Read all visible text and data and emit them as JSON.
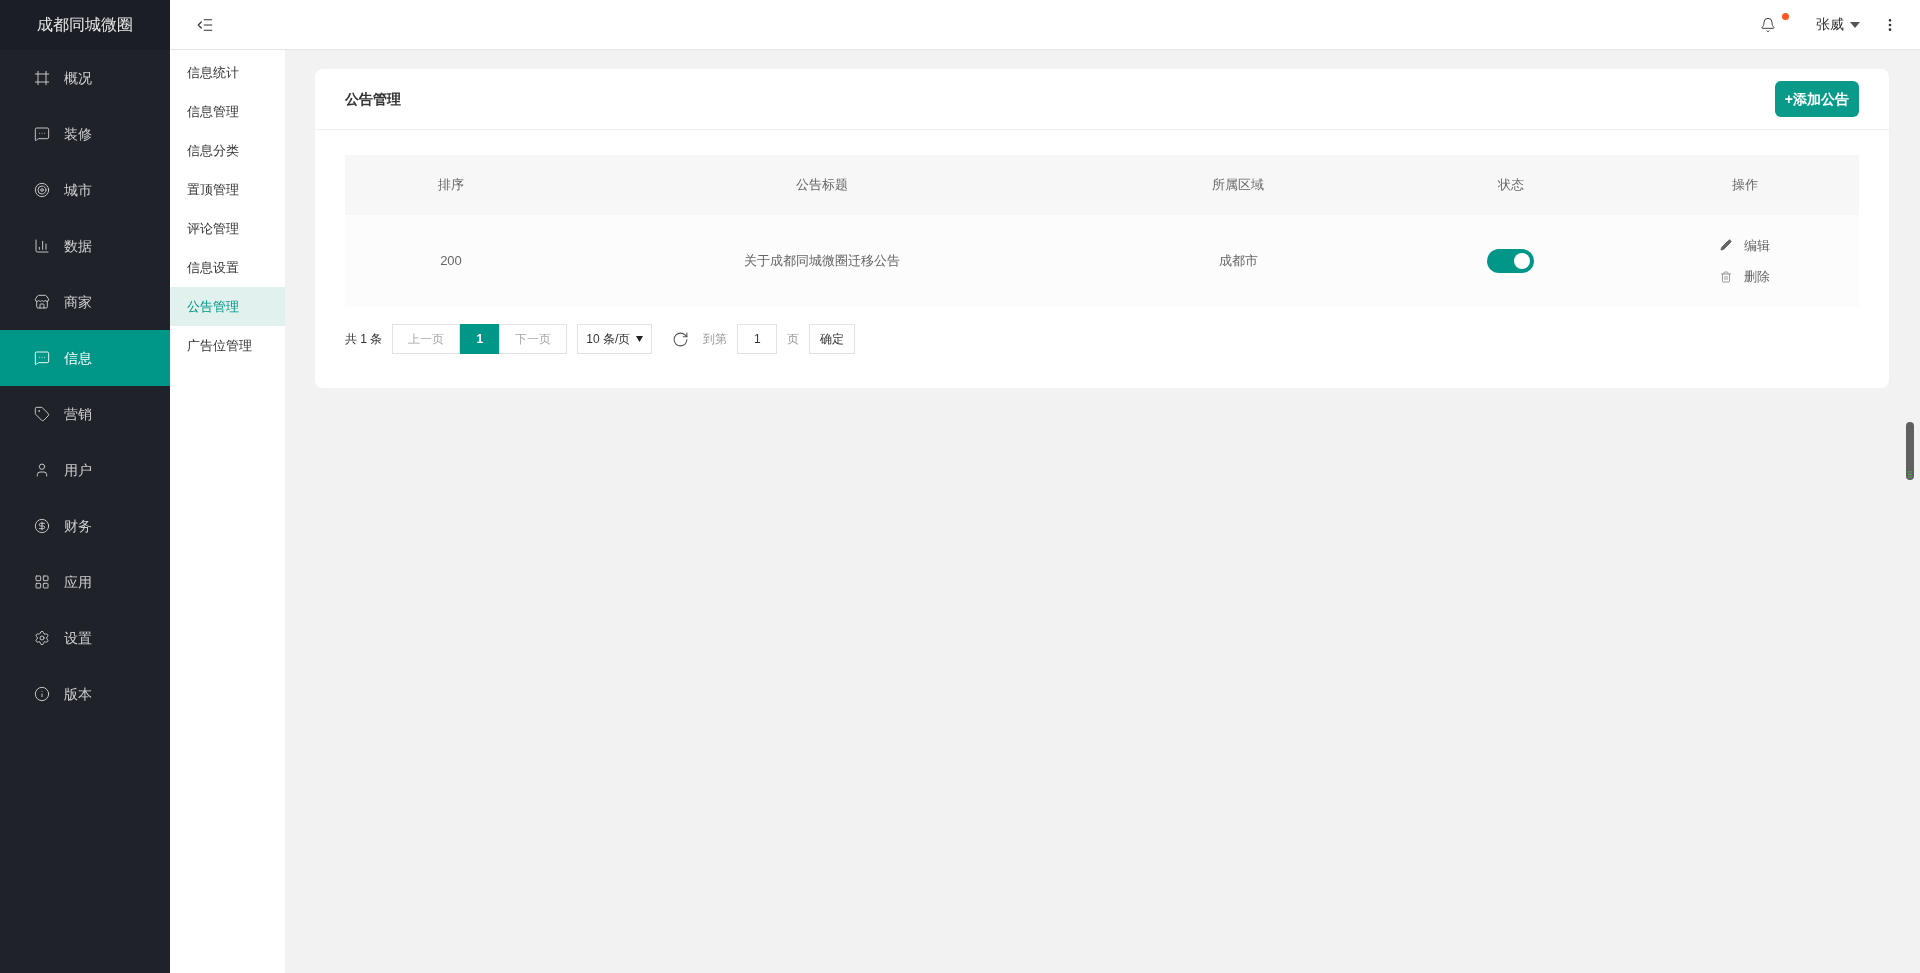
{
  "brand": "成都同城微圈",
  "sidebar": {
    "items": [
      {
        "label": "概况",
        "selected": false
      },
      {
        "label": "装修",
        "selected": false
      },
      {
        "label": "城市",
        "selected": false
      },
      {
        "label": "数据",
        "selected": false
      },
      {
        "label": "商家",
        "selected": false
      },
      {
        "label": "信息",
        "selected": true
      },
      {
        "label": "营销",
        "selected": false
      },
      {
        "label": "用户",
        "selected": false
      },
      {
        "label": "财务",
        "selected": false
      },
      {
        "label": "应用",
        "selected": false
      },
      {
        "label": "设置",
        "selected": false
      },
      {
        "label": "版本",
        "selected": false
      }
    ]
  },
  "submenu": {
    "items": [
      {
        "label": "信息统计",
        "selected": false
      },
      {
        "label": "信息管理",
        "selected": false
      },
      {
        "label": "信息分类",
        "selected": false
      },
      {
        "label": "置顶管理",
        "selected": false
      },
      {
        "label": "评论管理",
        "selected": false
      },
      {
        "label": "信息设置",
        "selected": false
      },
      {
        "label": "公告管理",
        "selected": true
      },
      {
        "label": "广告位管理",
        "selected": false
      }
    ]
  },
  "header": {
    "notification_dot": true,
    "user": "张威"
  },
  "card": {
    "title": "公告管理",
    "add_button": "+添加公告"
  },
  "table": {
    "columns": [
      "排序",
      "公告标题",
      "所属区域",
      "状态",
      "操作"
    ],
    "rows": [
      {
        "order": "200",
        "title": "关于成都同城微圈迁移公告",
        "region": "成都市",
        "status_on": true,
        "actions": [
          {
            "kind": "edit",
            "label": "编辑"
          },
          {
            "kind": "delete",
            "label": "删除"
          }
        ]
      }
    ]
  },
  "pagination": {
    "total": "共 1 条",
    "prev": {
      "label": "上一页",
      "disabled": true
    },
    "pages": [
      {
        "label": "1",
        "selected": true
      }
    ],
    "next": {
      "label": "下一页",
      "disabled": true
    },
    "page_size": "10 条/页",
    "goto_label": "到第",
    "goto_value": "1",
    "goto_suffix": "页",
    "confirm": "确定"
  }
}
